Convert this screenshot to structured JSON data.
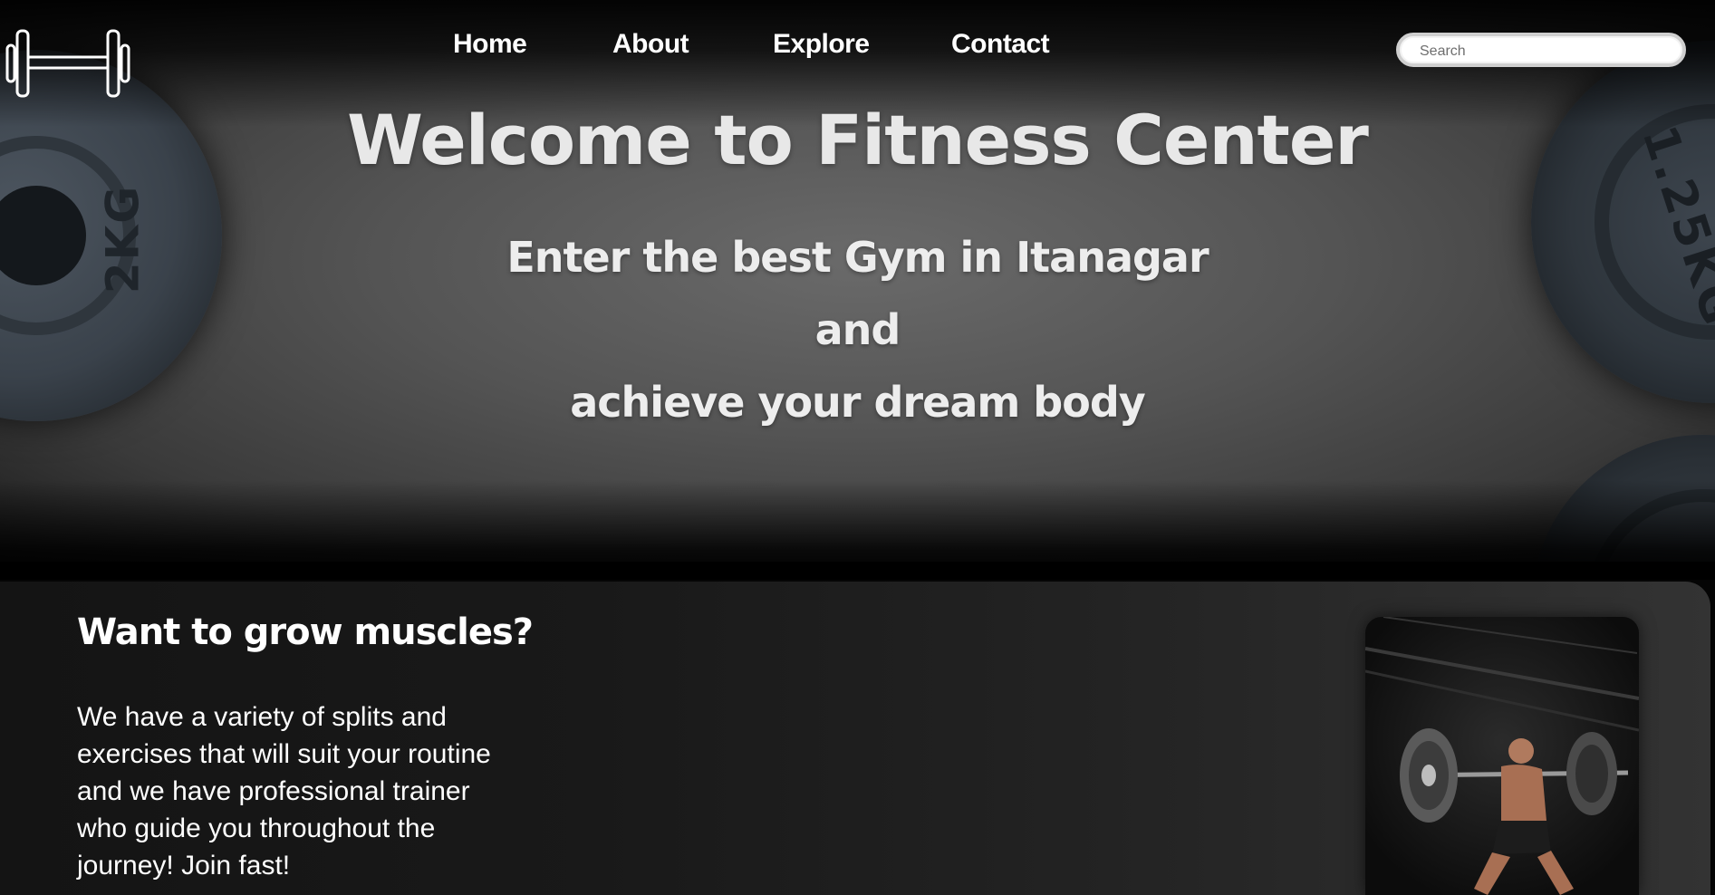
{
  "nav": {
    "home": "Home",
    "about": "About",
    "explore": "Explore",
    "contact": "Contact"
  },
  "search": {
    "placeholder": "Search"
  },
  "hero": {
    "title": "Welcome to Fitness Center",
    "line1": "Enter the best Gym in Itanagar",
    "line2": "and",
    "line3": "achieve your dream body",
    "plate_left_label": "2KG",
    "plate_right_label": "1.25KG"
  },
  "feature": {
    "title": "Want to grow muscles?",
    "lines": [
      "We have a variety of splits and",
      "exercises that will suit your routine",
      "and we have professional trainer",
      "who guide you throughout the",
      "journey! Join fast!"
    ]
  },
  "icons": {
    "logo": "dumbbell-icon",
    "photo": "athlete-squat-image"
  }
}
